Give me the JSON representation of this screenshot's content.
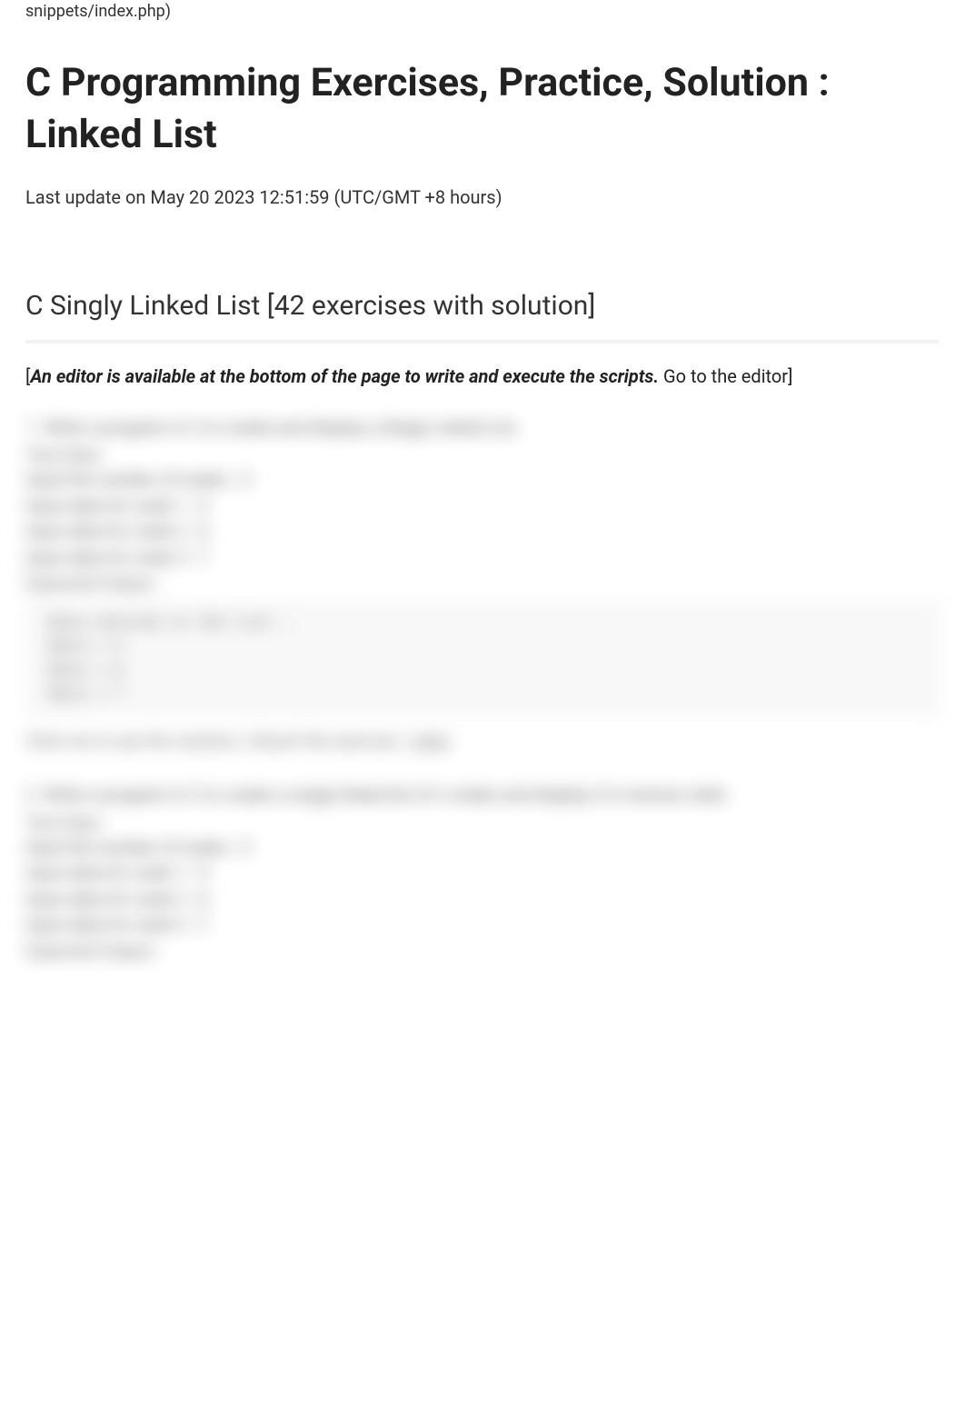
{
  "breadcrumb_tail": "snippets/index.php)",
  "page_title": "C Programming Exercises, Practice, Solution : Linked List",
  "last_update": "Last update on May 20 2023 12:51:59 (UTC/GMT +8 hours)",
  "section_heading": "C Singly Linked List [42 exercises with solution]",
  "editor_note": {
    "open_bracket": "[",
    "bold_italic": "An editor is available at the bottom of the page to write and execute the scripts.",
    "tail": " Go to the editor]"
  },
  "exercises": [
    {
      "num": "1.",
      "prompt": "Write a program in C to create and display a Singly Linked List.",
      "test_data_label": "Test Data :",
      "inputs": [
        "Input the number of nodes : 3",
        "Input data for node 1 : 5",
        "Input data for node 2 : 6",
        "Input data for node 3 : 7"
      ],
      "expected_label": "Expected Output :",
      "output": " Data entered in the list :\n Data = 5\n Data = 6\n Data = 7",
      "click_note": "Click me to see the solution | Attach the exercise / gdgs"
    },
    {
      "num": "2.",
      "prompt": "Write a program in C to create a singly linked list of n nodes and display it in reverse order.",
      "test_data_label": "Test Data :",
      "inputs": [
        "Input the number of nodes : 3",
        "Input data for node 1 : 5",
        "Input data for node 2 : 6",
        "Input data for node 3 : 7"
      ],
      "expected_label": "Expected Output :",
      "output": "",
      "click_note": ""
    }
  ]
}
